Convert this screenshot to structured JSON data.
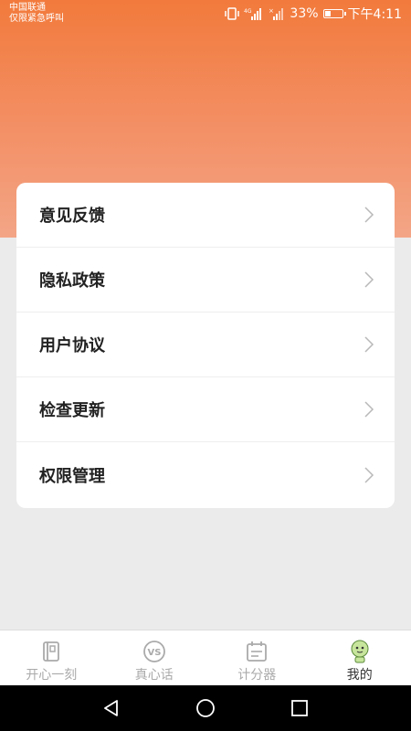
{
  "status_bar": {
    "carrier_line1": "中国联通",
    "carrier_line2": "仅限紧急呼叫",
    "battery_percent": "33%",
    "battery_level": 0.33,
    "time": "下午4:11"
  },
  "colors": {
    "header_top": "#f27a3c",
    "header_bottom": "#f3a586",
    "page_bg": "#ebebeb",
    "card_bg": "#ffffff",
    "active_tab_icon": "#c7e59c"
  },
  "menu": {
    "items": [
      {
        "label": "意见反馈"
      },
      {
        "label": "隐私政策"
      },
      {
        "label": "用户协议"
      },
      {
        "label": "检查更新"
      },
      {
        "label": "权限管理"
      }
    ]
  },
  "tabs": [
    {
      "label": "开心一刻",
      "icon": "book-icon",
      "active": false
    },
    {
      "label": "真心话",
      "icon": "vs-icon",
      "active": false
    },
    {
      "label": "计分器",
      "icon": "calendar-icon",
      "active": false
    },
    {
      "label": "我的",
      "icon": "avatar-icon",
      "active": true
    }
  ],
  "system_nav": [
    "back-icon",
    "home-icon",
    "recents-icon"
  ]
}
